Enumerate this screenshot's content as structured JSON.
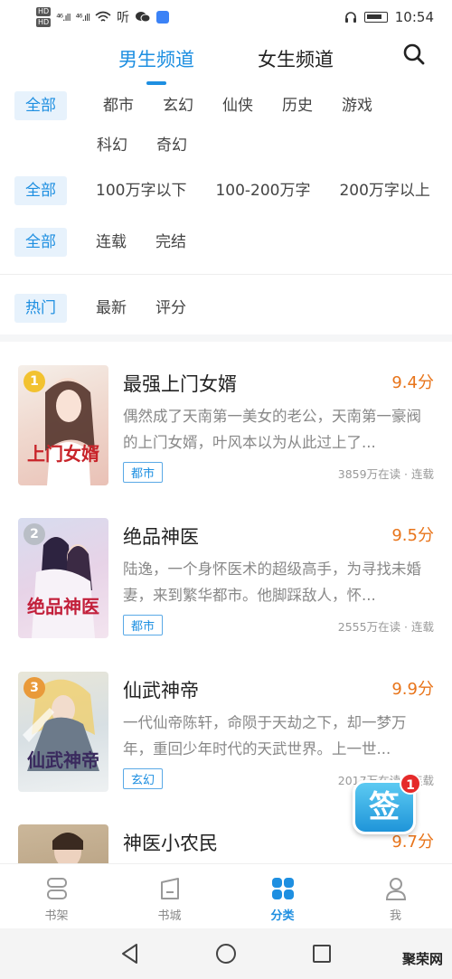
{
  "status_bar": {
    "time": "10:54",
    "hd1": "HD",
    "hd2": "HD",
    "signal1": "⁴⁶.ıll",
    "signal2": "⁴⁶.ıll",
    "listen": "听"
  },
  "channels": [
    {
      "label": "男生频道",
      "active": true
    },
    {
      "label": "女生频道",
      "active": false
    }
  ],
  "filters": {
    "genre": [
      "全部",
      "都市",
      "玄幻",
      "仙侠",
      "历史",
      "游戏",
      "科幻",
      "奇幻"
    ],
    "length": [
      "全部",
      "100万字以下",
      "100-200万字",
      "200万字以上"
    ],
    "status": [
      "全部",
      "连载",
      "完结"
    ],
    "sort": [
      "热门",
      "最新",
      "评分"
    ]
  },
  "books": [
    {
      "rank": "1",
      "title": "最强上门女婿",
      "score": "9.4分",
      "desc": "偶然成了天南第一美女的老公，天南第一豪阀的上门女婿，叶风本以为从此过上了...",
      "tag": "都市",
      "meta": "3859万在读 · 连载",
      "cover_text": "上门女婿",
      "cover_color": "#c8242a",
      "rank_color": "#f2c230"
    },
    {
      "rank": "2",
      "title": "绝品神医",
      "score": "9.5分",
      "desc": "陆逸，一个身怀医术的超级高手，为寻找未婚妻，来到繁华都市。他脚踩敌人，怀...",
      "tag": "都市",
      "meta": "2555万在读 · 连载",
      "cover_text": "绝品神医",
      "cover_color": "#c21f3a",
      "rank_color": "#b9bec6"
    },
    {
      "rank": "3",
      "title": "仙武神帝",
      "score": "9.9分",
      "desc": "一代仙帝陈轩，命陨于天劫之下，却一梦万年，重回少年时代的天武世界。上一世...",
      "tag": "玄幻",
      "meta": "2017万在读 · 连载",
      "cover_text": "仙武神帝",
      "cover_color": "#3a2a5e",
      "rank_color": "#e99a3a"
    },
    {
      "rank": "",
      "title": "神医小农民",
      "score": "9.7分",
      "desc": "",
      "tag": "",
      "meta": "",
      "cover_text": "",
      "cover_color": "#b89b72",
      "rank_color": ""
    }
  ],
  "sign_in": {
    "label": "签",
    "badge": "1"
  },
  "tabbar": [
    {
      "label": "书架",
      "icon": "bookshelf-icon",
      "active": false
    },
    {
      "label": "书城",
      "icon": "bookstore-icon",
      "active": false
    },
    {
      "label": "分类",
      "icon": "category-icon",
      "active": true
    },
    {
      "label": "我",
      "icon": "profile-icon",
      "active": false
    }
  ],
  "watermark": "聚荣网",
  "colors": {
    "accent": "#1e8fe1",
    "score": "#e8741a"
  }
}
